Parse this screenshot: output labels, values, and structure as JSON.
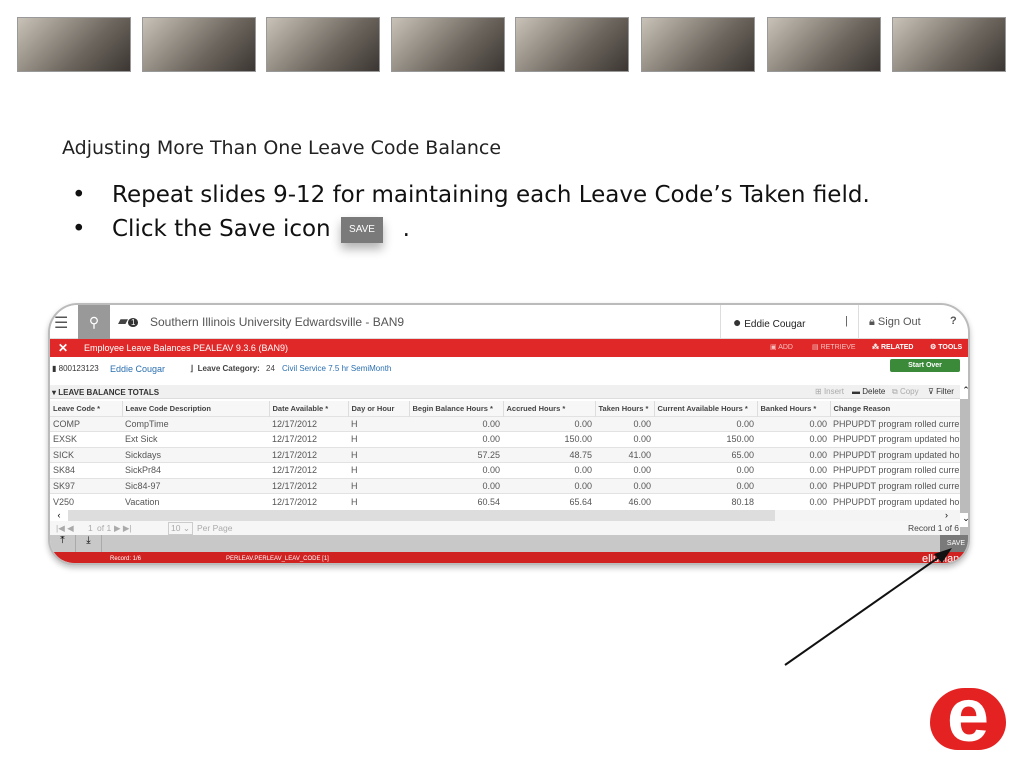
{
  "slide": {
    "photos": [
      "photo-1",
      "photo-2",
      "photo-3",
      "photo-4",
      "photo-5",
      "photo-6",
      "photo-7",
      "photo-8"
    ],
    "title": "Adjusting More Than One Leave Code Balance",
    "bullets": [
      "Repeat slides 9-12 for maintaining each Leave Code’s Taken field.",
      "Click the Save icon"
    ],
    "bullet_suffix": ".",
    "save_icon_label": "SAVE",
    "logo_letter": "e"
  },
  "app": {
    "title": "Southern Illinois University Edwardsville - BAN9",
    "notification_count": "1",
    "user": "Eddie Cougar",
    "sign_out": "Sign Out",
    "help": "?",
    "page_title": "Employee Leave Balances PEALEAV 9.3.6 (BAN9)",
    "actions": {
      "add": "ADD",
      "retrieve": "RETRIEVE",
      "related": "RELATED",
      "tools": "TOOLS"
    },
    "start_over": "Start Over",
    "key": {
      "id": "800123123",
      "name": "Eddie Cougar",
      "category_label": "Leave Category:",
      "category_code": "24",
      "category_desc": "Civil Service 7.5 hr SemiMonth"
    },
    "section": "LEAVE BALANCE TOTALS",
    "toolbar": {
      "insert": "Insert",
      "delete": "Delete",
      "copy": "Copy",
      "filter": "Filter"
    },
    "columns": [
      "Leave Code *",
      "Leave Code Description",
      "Date Available *",
      "Day or Hour",
      "Begin Balance Hours *",
      "Accrued Hours *",
      "Taken Hours *",
      "Current Available Hours *",
      "Banked Hours *",
      "Change Reason"
    ],
    "rows": [
      [
        "COMP",
        "CompTime",
        "12/17/2012",
        "H",
        "0.00",
        "0.00",
        "0.00",
        "0.00",
        "0.00",
        "PHPUPDT program rolled current h"
      ],
      [
        "EXSK",
        "Ext Sick",
        "12/17/2012",
        "H",
        "0.00",
        "150.00",
        "0.00",
        "150.00",
        "0.00",
        "PHPUPDT program updated hours"
      ],
      [
        "SICK",
        "Sickdays",
        "12/17/2012",
        "H",
        "57.25",
        "48.75",
        "41.00",
        "65.00",
        "0.00",
        "PHPUPDT program updated hours"
      ],
      [
        "SK84",
        "SickPr84",
        "12/17/2012",
        "H",
        "0.00",
        "0.00",
        "0.00",
        "0.00",
        "0.00",
        "PHPUPDT program rolled current h"
      ],
      [
        "SK97",
        "Sic84-97",
        "12/17/2012",
        "H",
        "0.00",
        "0.00",
        "0.00",
        "0.00",
        "0.00",
        "PHPUPDT program rolled current h"
      ],
      [
        "V250",
        "Vacation",
        "12/17/2012",
        "H",
        "60.54",
        "65.64",
        "46.00",
        "80.18",
        "0.00",
        "PHPUPDT program updated hours"
      ]
    ],
    "pager": {
      "page": "1",
      "of": "of 1",
      "per_page_value": "10",
      "per_page_label": "Per Page",
      "record": "Record 1 of 6"
    },
    "save": "SAVE",
    "status": {
      "record": "Record: 1/6",
      "field": "PERLEAV.PERLEAV_LEAV_CODE [1]",
      "brand": "ellucian"
    },
    "colors": {
      "red": "#e02828",
      "green": "#3a8a3a"
    }
  }
}
